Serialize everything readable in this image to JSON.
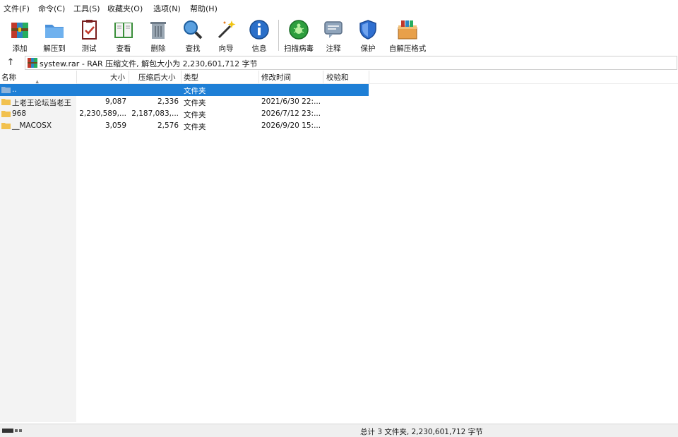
{
  "menu": [
    "文件(F)",
    "命令(C)",
    "工具(S)",
    "收藏夹(O)",
    "选项(N)",
    "帮助(H)"
  ],
  "toolbar": {
    "add": "添加",
    "extract": "解压到",
    "test": "测试",
    "view": "查看",
    "delete": "删除",
    "find": "查找",
    "wizard": "向导",
    "info": "信息",
    "scan": "扫描病毒",
    "comment": "注释",
    "protect": "保护",
    "sfx": "自解压格式"
  },
  "address": {
    "up_glyph": "↑",
    "text": "systew.rar - RAR 压缩文件, 解包大小为 2,230,601,712 字节"
  },
  "columns": {
    "name": "名称",
    "size": "大小",
    "packed": "压缩后大小",
    "type": "类型",
    "modified": "修改时间",
    "crc": "校验和"
  },
  "rows": [
    {
      "name": "..",
      "size": "",
      "packed": "",
      "type": "文件夹",
      "modified": "",
      "crc": "",
      "selected": true
    },
    {
      "name": "上老王论坛当老王",
      "size": "9,087",
      "packed": "2,336",
      "type": "文件夹",
      "modified": "2021/6/30 22:...",
      "crc": "",
      "selected": false
    },
    {
      "name": "968",
      "size": "2,230,589,...",
      "packed": "2,187,083,...",
      "type": "文件夹",
      "modified": "2026/7/12 23:...",
      "crc": "",
      "selected": false
    },
    {
      "name": "__MACOSX",
      "size": "3,059",
      "packed": "2,576",
      "type": "文件夹",
      "modified": "2026/9/20 15:...",
      "crc": "",
      "selected": false
    }
  ],
  "status": {
    "summary": "总计 3 文件夹, 2,230,601,712 字节"
  },
  "colors": {
    "selection": "#1e7fd6",
    "folder": "#f2c14e"
  }
}
